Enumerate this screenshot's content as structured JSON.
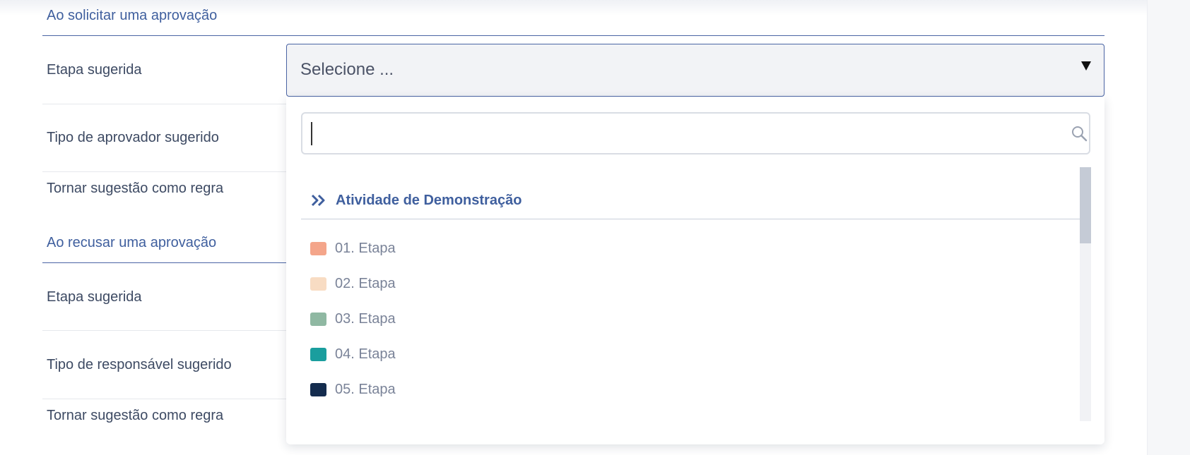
{
  "sections": [
    {
      "title": "Ao solicitar uma aprovação"
    },
    {
      "title": "Ao recusar uma aprovação"
    }
  ],
  "approval_rows": [
    {
      "label": "Etapa sugerida"
    },
    {
      "label": "Tipo de aprovador sugerido"
    },
    {
      "label": "Tornar sugestão como regra"
    }
  ],
  "refusal_rows": [
    {
      "label": "Etapa sugerida"
    },
    {
      "label": "Tipo de responsável sugerido"
    },
    {
      "label": "Tornar sugestão como regra"
    }
  ],
  "select": {
    "value": "Selecione ..."
  },
  "dropdown": {
    "search_value": "",
    "search_icon": "search-icon",
    "group": {
      "label": "Atividade de Demonstração",
      "icon": "double-chevron-right-icon"
    },
    "options": [
      {
        "label": "01. Etapa",
        "color": "#f4a58a"
      },
      {
        "label": "02. Etapa",
        "color": "#f8dcc3"
      },
      {
        "label": "03. Etapa",
        "color": "#8fb8a2"
      },
      {
        "label": "04. Etapa",
        "color": "#1a9e9e"
      },
      {
        "label": "05. Etapa",
        "color": "#142c4e"
      }
    ]
  },
  "colors": {
    "accent": "#3f5f9e",
    "select_border": "#4a64a4"
  }
}
